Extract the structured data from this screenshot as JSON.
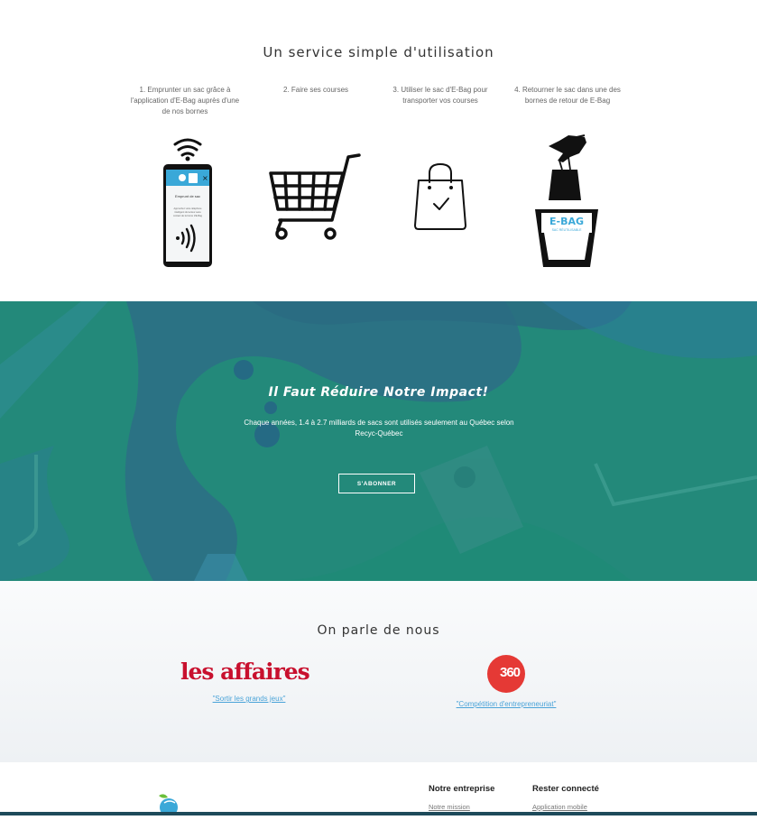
{
  "service": {
    "title": "Un service simple d'utilisation",
    "steps": [
      {
        "text": "1. Emprunter un sac grâce à l'application d'E-Bag auprès d'une de nos bornes",
        "icon": "phone-nfc-icon"
      },
      {
        "text": "2. Faire ses courses",
        "icon": "shopping-cart-icon"
      },
      {
        "text": "3. Utiliser le sac d'E-Bag pour transporter vos courses",
        "icon": "shopping-bag-check-icon"
      },
      {
        "text": "4. Retourner le sac dans une des bornes de retour de E-Bag",
        "icon": "return-bin-icon"
      }
    ],
    "phone_screen": {
      "title": "Emprunt de sac",
      "text": "Approchez votre téléphone intelligent du lecteur sans contact de la borne d'E-Bag"
    },
    "bin_label": "E-BAG",
    "bin_sublabel": "SAC RÉUTILISABLE"
  },
  "impact": {
    "title": "Il Faut Réduire Notre Impact!",
    "text": "Chaque années, 1.4 à 2.7 milliards de sacs sont utilisés seulement au Québec selon Recyc-Québec",
    "button": "S'ABONNER",
    "colors": {
      "background": "#1f8a77",
      "accent": "#2f7fa0"
    }
  },
  "press": {
    "title": "On parle de nous",
    "outlets": [
      {
        "logo": "les affaires",
        "link": "\"Sortir les grands jeux\""
      },
      {
        "logo": "360",
        "link": "\"Compétition d'entrepreneuriat\""
      }
    ]
  },
  "footer": {
    "logo_icon": "ebag-leaf-logo",
    "columns": [
      {
        "heading": "Notre entreprise",
        "first_link": "Notre mission"
      },
      {
        "heading": "Rester connecté",
        "first_link": "Application mobile"
      }
    ]
  }
}
